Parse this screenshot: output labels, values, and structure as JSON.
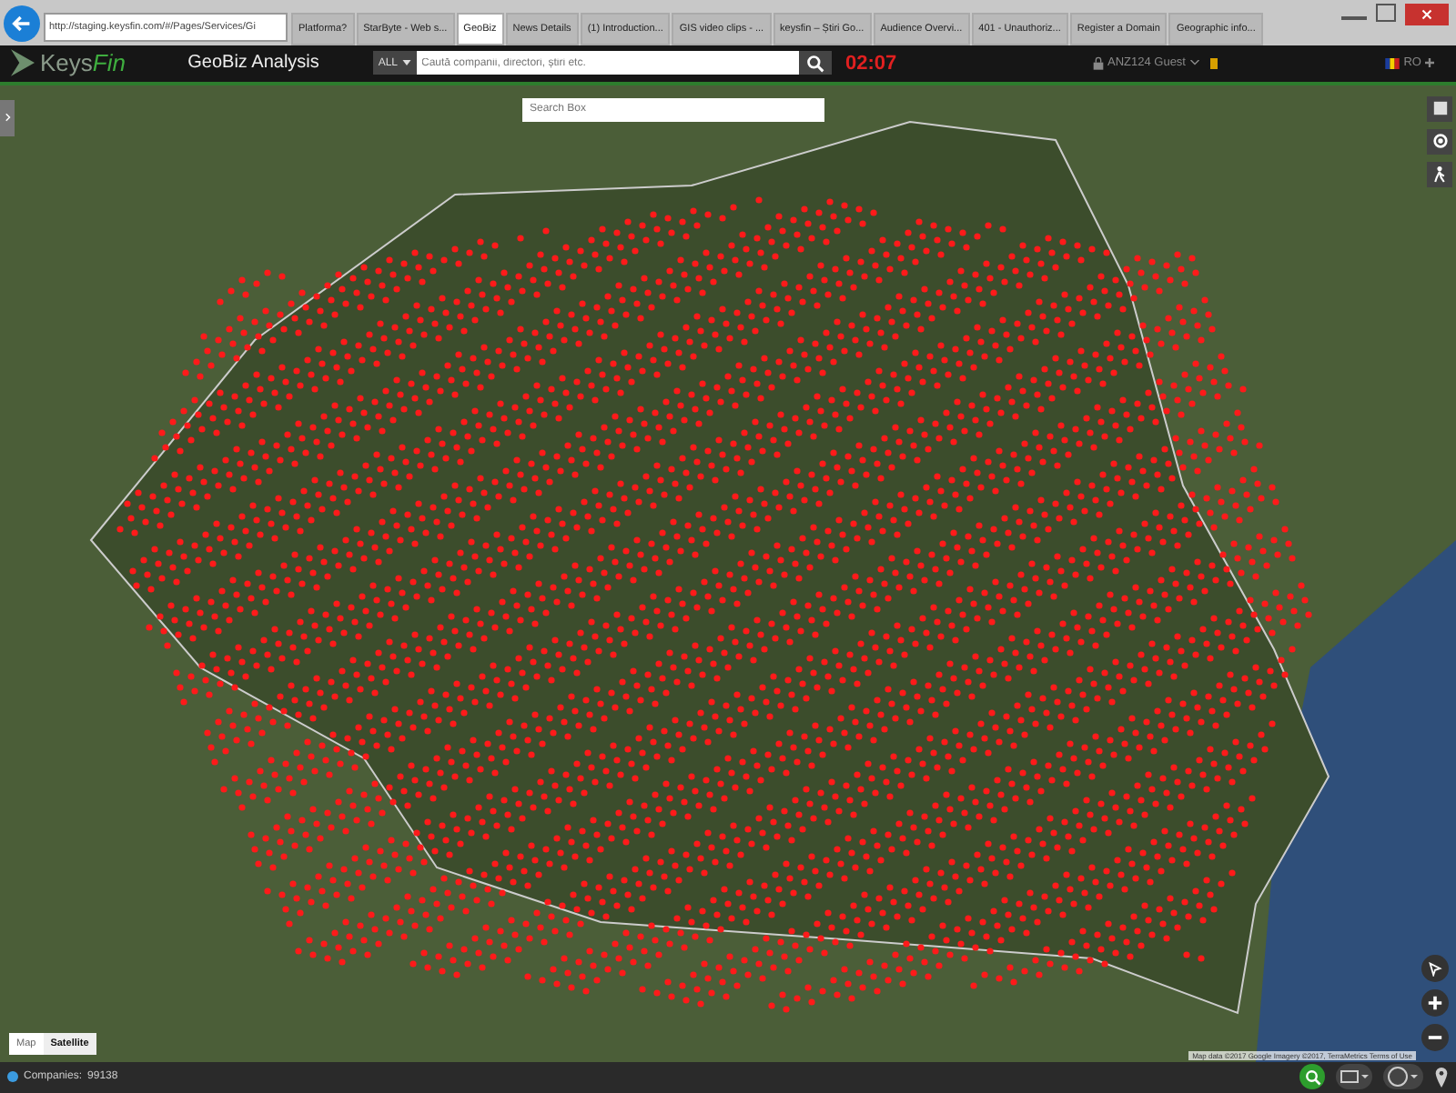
{
  "browser": {
    "address": "http://staging.keysfin.com/#/Pages/Services/Gi",
    "tabs": [
      {
        "label": "Platforma?",
        "selected": false
      },
      {
        "label": "StarByte - Web s...",
        "selected": false
      },
      {
        "label": "GeoBiz",
        "selected": true
      },
      {
        "label": "News Details",
        "selected": false
      },
      {
        "label": "(1) Introduction...",
        "selected": false
      },
      {
        "label": "GIS video clips - ...",
        "selected": false
      },
      {
        "label": "keysfin – Știri Go...",
        "selected": false
      },
      {
        "label": "Audience Overvi...",
        "selected": false
      },
      {
        "label": "401 - Unauthoriz...",
        "selected": false
      },
      {
        "label": "Register a Domain",
        "selected": false
      },
      {
        "label": "Geographic info...",
        "selected": false
      }
    ]
  },
  "header": {
    "logo_main": "Keys",
    "logo_accent": "Fin",
    "title": "GeoBiz Analysis",
    "scope": "ALL",
    "search_placeholder": "Caută companii, directori, știri etc.",
    "timer": "02:07",
    "user": "ANZ124 Guest",
    "language": "RO"
  },
  "map": {
    "search_placeholder": "Search Box",
    "map_types": [
      {
        "label": "Map",
        "selected": false
      },
      {
        "label": "Satellite",
        "selected": true
      }
    ],
    "attribution": "Map data ©2017 Google Imagery ©2017, TerraMetrics  Terms of Use"
  },
  "status_bar": {
    "label": "Companies:",
    "count": "99138"
  }
}
